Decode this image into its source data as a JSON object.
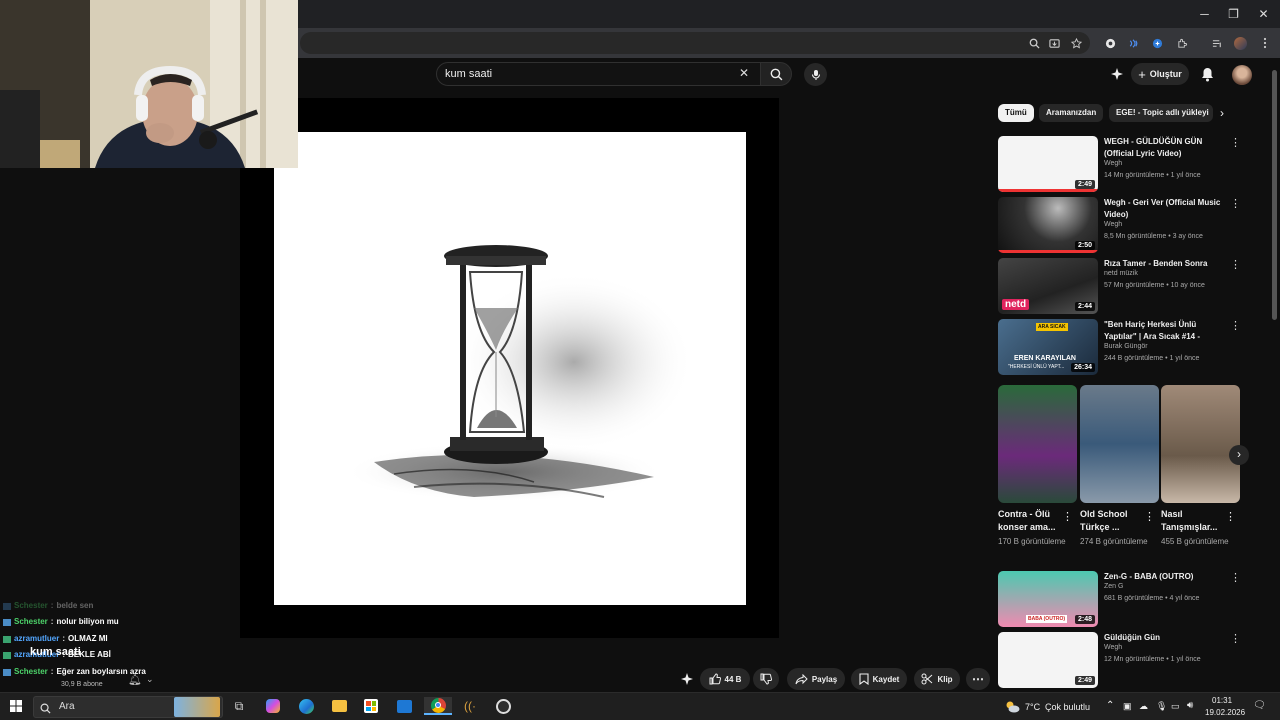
{
  "window": {
    "minimize": "─",
    "restore": "❐",
    "close": "✕"
  },
  "browser_icons": [
    "zoom-icon",
    "install-icon",
    "star-icon",
    "extension-1-icon",
    "extension-2-icon",
    "extension-3-icon",
    "puzzle-icon",
    "media-icon",
    "profile-icon",
    "more-icon"
  ],
  "youtube": {
    "search_value": "kum saati",
    "clear": "✕",
    "create_label": "Oluştur",
    "chips": [
      "Tümü",
      "Aramanızdan",
      "EGE! - Topic adlı yükleyi"
    ],
    "videos_top": [
      {
        "title": "WEGH - GÜLDÜĞÜN GÜN (Official Lyric Video)",
        "channel": "Wegh",
        "meta": "14 Mn görüntüleme • 1 yıl önce",
        "duration": "2:49"
      },
      {
        "title": "Wegh - Geri Ver (Official Music Video)",
        "channel": "Wegh",
        "meta": "8,5 Mn görüntüleme • 3 ay önce",
        "duration": "2:50"
      },
      {
        "title": "Rıza Tamer - Benden Sonra",
        "channel": "netd müzik",
        "meta": "57 Mn görüntüleme • 10 ay önce",
        "duration": "2:44"
      },
      {
        "title": "\"Ben Hariç Herkesi Ünlü Yaptılar\" | Ara Sıcak #14 - Eren...",
        "channel": "Burak Güngör",
        "meta": "244 B görüntüleme • 1 yıl önce",
        "duration": "26:34"
      }
    ],
    "shorts": [
      {
        "title": "Contra - Ölü konser ama...",
        "views": "170 B görüntüleme"
      },
      {
        "title": "Old School Türkçe ...",
        "views": "274 B görüntüleme"
      },
      {
        "title": "Nasıl Tanışmışlar...",
        "views": "455 B görüntüleme"
      }
    ],
    "videos_bottom": [
      {
        "title": "Zen-G - BABA (OUTRO)",
        "channel": "Zen G",
        "meta": "681 B görüntüleme • 4 yıl önce",
        "duration": "2:48"
      },
      {
        "title": "Güldüğün Gün",
        "channel": "Wegh",
        "meta": "12 Mn görüntüleme • 1 yıl önce",
        "duration": "2:49"
      }
    ],
    "thumb_texts": {
      "netd": "netd",
      "eren": "EREN KARAYILAN",
      "eren_sub": "\"HERKESİ ÜNLÜ YAPT...",
      "ara_sicak": "ARA SICAK",
      "baba": "BABA (OUTRO)"
    },
    "actions": {
      "likes": "44 B",
      "share": "Paylaş",
      "save": "Kaydet",
      "clip": "Klip"
    }
  },
  "chat": [
    {
      "user": "Schester",
      "msg": "belde sen",
      "faded": true
    },
    {
      "user": "Schester",
      "msg": "nolur biliyon mu",
      "faded": false
    },
    {
      "user": "azramutluer",
      "msg": "OLMAZ MI",
      "faded": false
    },
    {
      "user": "azramutluer",
      "msg": "BEKLE ABİ",
      "faded": false
    },
    {
      "user": "Schester",
      "msg": "Eğer zan boylarsın azra",
      "faded": false
    }
  ],
  "overlay": {
    "song": "kum saati",
    "subs": "30,9 B abone"
  },
  "taskbar": {
    "search_placeholder": "Ara",
    "weather_temp": "7°C",
    "weather_desc": "Çok bulutlu",
    "time": "01:31",
    "date": "19.02.2026"
  },
  "colors": {
    "accent": "#3ea6ff",
    "bg": "#0f0f0f",
    "chip_active": "#f1f1f1",
    "chat_green": "#4dd36a",
    "chat_blue": "#53a7ff"
  }
}
